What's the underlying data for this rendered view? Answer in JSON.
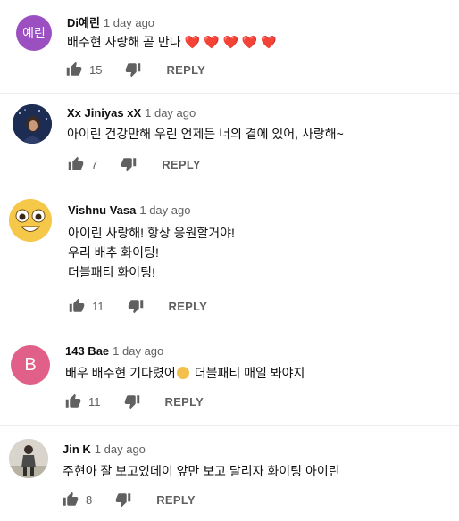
{
  "comments": [
    {
      "author": "Di예린",
      "avatar_text": "예린",
      "avatar_color": "#9c4fc1",
      "time": "1 day ago",
      "text_lines": [
        "배주현 사랑해 곧 만나"
      ],
      "likes": "15",
      "reply_label": "REPLY"
    },
    {
      "author": "Xx Jiniyas xX",
      "time": "1 day ago",
      "text_lines": [
        "아이린 건강만해 우린 언제든 너의 곁에 있어, 사랑해~"
      ],
      "likes": "7",
      "reply_label": "REPLY"
    },
    {
      "author": "Vishnu Vasa",
      "time": "1 day ago",
      "text_lines": [
        "아이린 사랑해! 항상 응원할거야!",
        "우리 배추 화이팅!",
        "더블패티 화이팅!"
      ],
      "likes": "11",
      "reply_label": "REPLY"
    },
    {
      "author": "143 Bae",
      "avatar_text": "B",
      "avatar_color": "#e0608a",
      "time": "1 day ago",
      "text_lines": [
        "배우 배주현 기다렸어",
        "더블패티 매일 봐야지"
      ],
      "likes": "11",
      "reply_label": "REPLY"
    },
    {
      "author": "Jin K",
      "time": "1 day ago",
      "text_lines": [
        "주현아 잘 보고있데이 앞만 보고 달리자 화이팅 아이린"
      ],
      "likes": "8",
      "reply_label": "REPLY"
    }
  ],
  "icons": {
    "like": "thumbs-up-icon",
    "dislike": "thumbs-down-icon",
    "heart": "red-heart-emoji",
    "smile": "smiling-face-emoji"
  },
  "colors": {
    "heart": "#e03a3a",
    "meta_gray": "#606060"
  }
}
